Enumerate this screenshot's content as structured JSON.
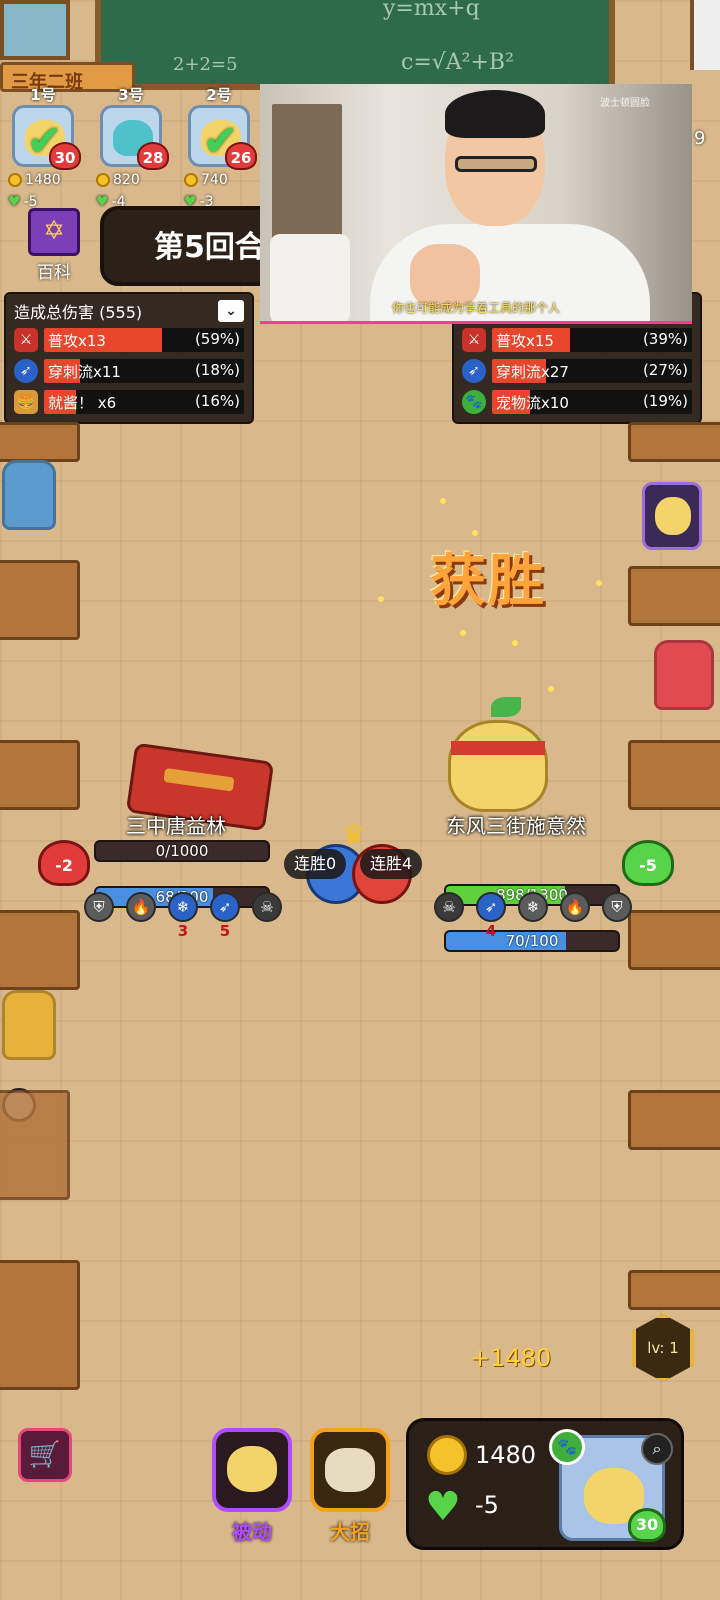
{
  "room": {
    "class_sign": "三年二班",
    "chalk": [
      "y=mx+q",
      "2+2=5",
      "c=√A²+B²"
    ]
  },
  "players": [
    {
      "num": "1号",
      "hearts": "30",
      "coins": "1480",
      "delta": "-5",
      "checked": true
    },
    {
      "num": "3号",
      "hearts": "28",
      "coins": "820",
      "delta": "-4",
      "checked": false
    },
    {
      "num": "2号",
      "hearts": "26",
      "coins": "740",
      "delta": "-3",
      "checked": true
    }
  ],
  "encyclopedia": {
    "label": "百科",
    "icon": "star-book-icon"
  },
  "round": {
    "label": "第5回合"
  },
  "damage_left": {
    "header": "造成总伤害 (555)",
    "rows": [
      {
        "icon": "sword-icon",
        "name": "普攻x13",
        "pct": "(59%)",
        "fill": 0.59,
        "color": "#e8452d"
      },
      {
        "icon": "pierce-icon",
        "name": "穿刺流x11",
        "pct": "(18%)",
        "fill": 0.18,
        "color": "#e8452d"
      },
      {
        "icon": "burger-icon",
        "name": "就酱！ x6",
        "pct": "(16%)",
        "fill": 0.16,
        "color": "#e8452d"
      }
    ]
  },
  "damage_right": {
    "rows": [
      {
        "icon": "sword-icon",
        "name": "普攻x15",
        "pct": "(39%)",
        "fill": 0.39,
        "color": "#e8452d"
      },
      {
        "icon": "pierce-icon",
        "name": "穿刺流x27",
        "pct": "(27%)",
        "fill": 0.27,
        "color": "#e8452d"
      },
      {
        "icon": "paw-icon",
        "name": "宠物流x10",
        "pct": "(19%)",
        "fill": 0.19,
        "color": "#e8452d"
      }
    ],
    "side_number": "9"
  },
  "video": {
    "watermark": "波士顿圆脸",
    "subtitle": "你也可能成为享着工具的那个人"
  },
  "battle": {
    "victory": "获胜",
    "left": {
      "name": "三中唐益林",
      "hp_text": "0/1000",
      "hp_fill": 0.0,
      "energy_text": "68/100",
      "energy_fill": 0.68,
      "heart": "-2",
      "streak": "连胜0",
      "skills": [
        {
          "icon": "shield-icon",
          "count": ""
        },
        {
          "icon": "fire-icon",
          "count": ""
        },
        {
          "icon": "snowflake-icon",
          "count": "3"
        },
        {
          "icon": "pierce-icon",
          "count": "5"
        },
        {
          "icon": "skull-icon",
          "count": ""
        }
      ]
    },
    "right": {
      "name": "东风三街施意然",
      "hp_text": "898/1300",
      "hp_fill": 0.69,
      "energy_text": "70/100",
      "energy_fill": 0.7,
      "heart": "-5",
      "streak": "连胜4",
      "skills": [
        {
          "icon": "skull-icon",
          "count": ""
        },
        {
          "icon": "pierce-icon",
          "count": "4"
        },
        {
          "icon": "snowflake-icon",
          "count": ""
        },
        {
          "icon": "fire-icon",
          "count": ""
        },
        {
          "icon": "shield-icon",
          "count": ""
        }
      ]
    }
  },
  "bottom": {
    "gain": "+1480",
    "level": "lv: 1",
    "passive_label": "被动",
    "ultimate_label": "大招",
    "coins": "1480",
    "hearts_delta": "-5",
    "pet_hearts": "30"
  },
  "colors": {
    "hp_green": "#5fd13c",
    "energy_blue": "#4a8fe0",
    "victory_orange": "#ffa43a",
    "passive_purple": "#b04cff",
    "ultimate_orange": "#f5a21b"
  }
}
